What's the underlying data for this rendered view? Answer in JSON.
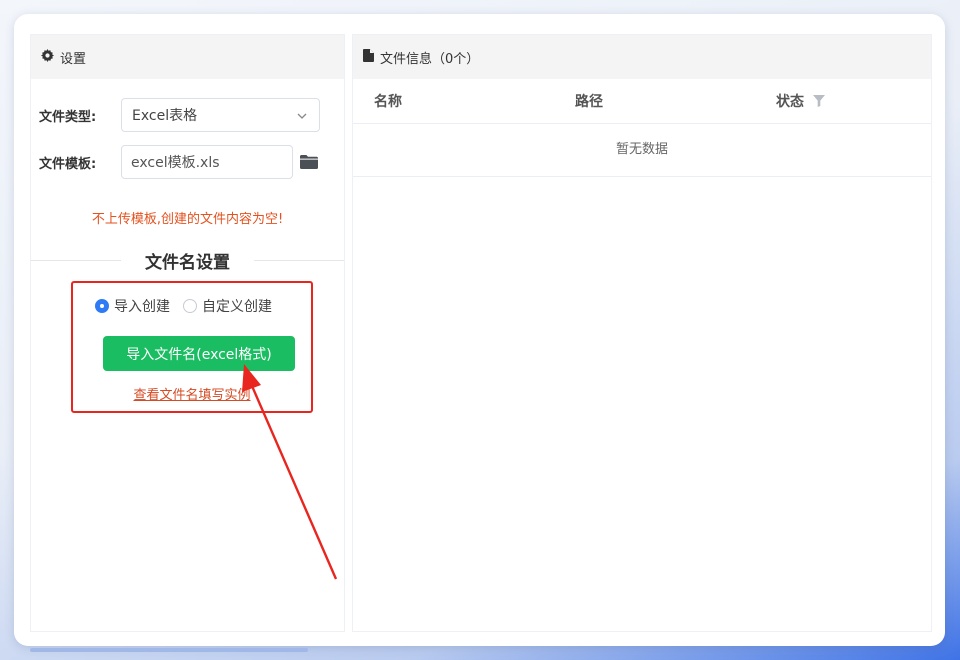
{
  "settings_panel": {
    "title": "设置",
    "icon": "gear-icon",
    "file_type": {
      "label": "文件类型:",
      "value": "Excel表格"
    },
    "file_template": {
      "label": "文件模板:",
      "value": "excel模板.xls"
    },
    "warning": "不上传模板,创建的文件内容为空!",
    "filename_section": {
      "title": "文件名设置",
      "radio_options": [
        {
          "label": "导入创建",
          "selected": true
        },
        {
          "label": "自定义创建",
          "selected": false
        }
      ],
      "import_button": "导入文件名(excel格式)",
      "example_link": "查看文件名填写实例"
    }
  },
  "file_info_panel": {
    "title": "文件信息（0个）",
    "icon": "document-icon",
    "columns": [
      "名称",
      "路径",
      "状态"
    ],
    "empty_text": "暂无数据"
  },
  "colors": {
    "accent_green": "#1bbd62",
    "warning_orange": "#e4521f",
    "highlight_red": "#e8261f",
    "radio_blue": "#2f7bf6"
  }
}
